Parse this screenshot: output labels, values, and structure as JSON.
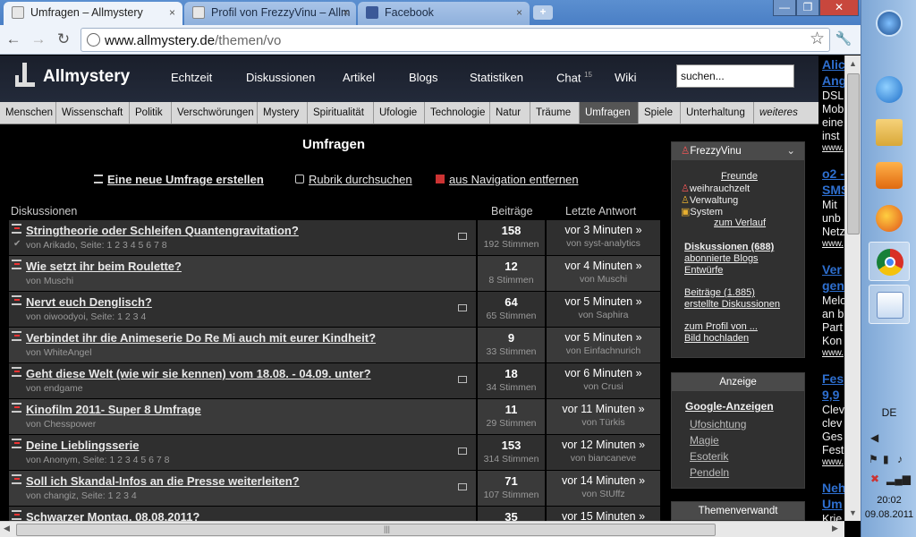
{
  "browser": {
    "tabs": [
      {
        "title": "Umfragen – Allmystery",
        "close": "×"
      },
      {
        "title": "Profil von FrezzyVinu – Allm",
        "close": "×"
      },
      {
        "title": "Facebook",
        "close": "×"
      }
    ],
    "newtab_label": "+",
    "window_controls": {
      "minimize": "—",
      "restore": "❐",
      "close": "✕"
    },
    "url_host": "www.allmystery.de",
    "url_path": "/themen/vo",
    "icons": {
      "back": "back-arrow-icon",
      "forward": "forward-arrow-icon",
      "reload": "reload-icon",
      "bookmark": "star-icon",
      "settings": "wrench-icon"
    }
  },
  "site": {
    "logo": "Allmystery",
    "nav": [
      {
        "label": "Echtzeit"
      },
      {
        "label": "Diskussionen"
      },
      {
        "label": "Artikel"
      },
      {
        "label": "Blogs"
      },
      {
        "label": "Statistiken"
      },
      {
        "label": "Chat",
        "badge": "15"
      },
      {
        "label": "Wiki"
      }
    ],
    "search_placeholder": "suchen...",
    "categories": [
      "Menschen",
      "Wissenschaft",
      "Politik",
      "Verschwörungen",
      "Mystery",
      "Spiritualität",
      "Ufologie",
      "Technologie",
      "Natur",
      "Träume",
      "Umfragen",
      "Spiele",
      "Unterhaltung",
      "weiteres"
    ],
    "selected_category": "Umfragen"
  },
  "main": {
    "title": "Umfragen",
    "actions": {
      "new_poll": "Eine neue Umfrage erstellen",
      "browse": "Rubrik durchsuchen",
      "remove": "aus Navigation entfernen"
    },
    "columns": {
      "discussions": "Diskussionen",
      "posts": "Beiträge",
      "last_reply": "Letzte Antwort"
    },
    "threads": [
      {
        "title": "Stringtheorie oder Schleifen Quantengravitation?",
        "meta": "von Arikado, Seite: 1 2 3 4 5 6 7 8",
        "posts": "158",
        "votes": "192 Stimmen",
        "when": "vor 3 Minuten »",
        "by": "von syst-analytics"
      },
      {
        "title": "Wie setzt ihr beim Roulette?",
        "meta": "von Muschi",
        "posts": "12",
        "votes": "8 Stimmen",
        "when": "vor 4 Minuten »",
        "by": "von Muschi"
      },
      {
        "title": "Nervt euch Denglisch?",
        "meta": "von oiwoodyoi, Seite: 1 2 3 4",
        "posts": "64",
        "votes": "65 Stimmen",
        "when": "vor 5 Minuten »",
        "by": "von Saphira"
      },
      {
        "title": "Verbindet ihr die Animeserie Do Re Mi auch mit eurer Kindheit?",
        "meta": "von WhiteAngel",
        "posts": "9",
        "votes": "33 Stimmen",
        "when": "vor 5 Minuten »",
        "by": "von Einfachnurich"
      },
      {
        "title": "Geht diese Welt (wie wir sie kennen) vom 18.08. - 04.09. unter?",
        "meta": "von endgame",
        "posts": "18",
        "votes": "34 Stimmen",
        "when": "vor 6 Minuten »",
        "by": "von Crusi"
      },
      {
        "title": "Kinofilm 2011- Super 8 Umfrage",
        "meta": "von Chesspower",
        "posts": "11",
        "votes": "29 Stimmen",
        "when": "vor 11 Minuten »",
        "by": "von Türkis"
      },
      {
        "title": "Deine Lieblingsserie",
        "meta": "von Anonym, Seite: 1 2 3 4 5 6 7 8",
        "posts": "153",
        "votes": "314 Stimmen",
        "when": "vor 12 Minuten »",
        "by": "von biancaneve"
      },
      {
        "title": "Soll ich Skandal-Infos an die Presse weiterleiten?",
        "meta": "von changiz, Seite: 1 2 3 4",
        "posts": "71",
        "votes": "107 Stimmen",
        "when": "vor 14 Minuten »",
        "by": "von StUffz"
      },
      {
        "title": "Schwarzer Montag, 08.08.2011?",
        "meta": "",
        "posts": "35",
        "votes": "",
        "when": "vor 15 Minuten »",
        "by": ""
      }
    ]
  },
  "user_panel": {
    "username": "FrezzyVinu",
    "chevron": "⌄",
    "friends": "Freunde",
    "friends_list": [
      "weihrauchzelt",
      "Verwaltung",
      "System"
    ],
    "history": "zum Verlauf",
    "discussions": "Diskussionen (688)",
    "subscribed_blogs": "abonnierte Blogs",
    "drafts": "Entwürfe",
    "posts": "Beiträge (1.885)",
    "created": "erstellte Diskussionen",
    "profile": "zum Profil von ...",
    "upload": "Bild hochladen"
  },
  "ads_panel": {
    "title": "Anzeige",
    "heading": "Google-Anzeigen",
    "links": [
      "Ufosichtung",
      "Magie",
      "Esoterik",
      "Pendeln"
    ]
  },
  "related_panel": {
    "title": "Themenverwandt"
  },
  "right_column": [
    {
      "type": "h",
      "text": "Alic"
    },
    {
      "type": "h",
      "text": "Ang"
    },
    {
      "type": "t",
      "text": "DSL"
    },
    {
      "type": "t",
      "text": "Mob"
    },
    {
      "type": "t",
      "text": "eine"
    },
    {
      "type": "t",
      "text": "inst"
    },
    {
      "type": "l",
      "text": "www."
    },
    {
      "type": "h",
      "text": "o2 -"
    },
    {
      "type": "h",
      "text": "SMS"
    },
    {
      "type": "t",
      "text": "Mit"
    },
    {
      "type": "t",
      "text": "unb"
    },
    {
      "type": "t",
      "text": "Netz"
    },
    {
      "type": "l",
      "text": "www."
    },
    {
      "type": "h",
      "text": "Ver"
    },
    {
      "type": "h",
      "text": "gen"
    },
    {
      "type": "t",
      "text": "Melo"
    },
    {
      "type": "t",
      "text": "an b"
    },
    {
      "type": "t",
      "text": "Part"
    },
    {
      "type": "t",
      "text": "Kon"
    },
    {
      "type": "l",
      "text": "www."
    },
    {
      "type": "h",
      "text": "Fes"
    },
    {
      "type": "h",
      "text": "9,9"
    },
    {
      "type": "t",
      "text": "Clev"
    },
    {
      "type": "t",
      "text": "clev"
    },
    {
      "type": "t",
      "text": "Ges"
    },
    {
      "type": "t",
      "text": "Fest"
    },
    {
      "type": "l",
      "text": "www."
    },
    {
      "type": "h",
      "text": "Neh"
    },
    {
      "type": "h",
      "text": "Um"
    },
    {
      "type": "t",
      "text": "Krie"
    }
  ],
  "taskbar": {
    "apps": [
      "start-orb-icon",
      "internet-explorer-icon",
      "folder-icon",
      "media-player-icon",
      "firefox-icon",
      "chrome-icon",
      "word-icon"
    ],
    "language": "DE",
    "time": "20:02",
    "date": "09.08.2011"
  },
  "colors": {
    "accent_link": "#2e6fcf",
    "page_bg": "#000000",
    "row_bg": "#2f2f2f",
    "selected_tab": "#555555"
  }
}
